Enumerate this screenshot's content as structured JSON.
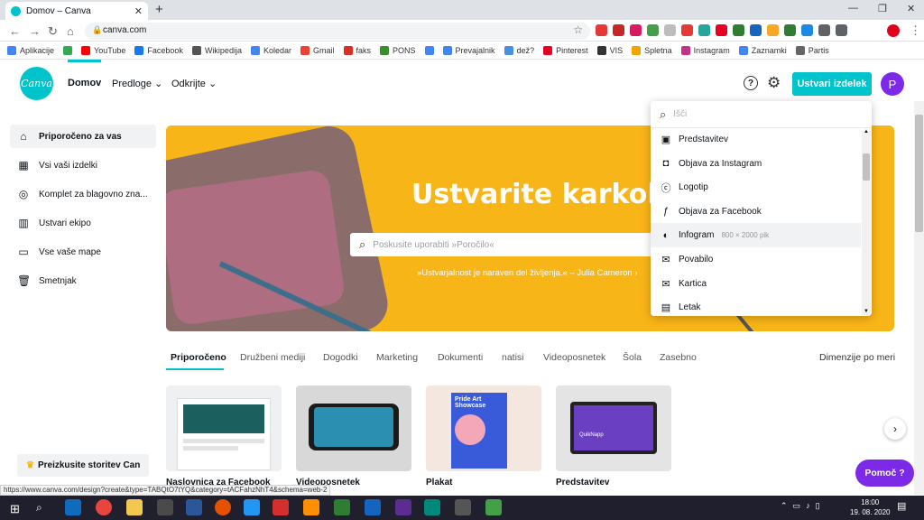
{
  "browser": {
    "tab_title": "Domov – Canva",
    "url": "canva.com",
    "status_url": "https://www.canva.com/design?create&type=TABQtO7tYQ&category=tACFahzNhT4&schema=web-2",
    "bookmarks": [
      {
        "label": "Aplikacije",
        "color": "#4285f4"
      },
      {
        "label": "",
        "color": "#34a853"
      },
      {
        "label": "YouTube",
        "color": "#ff0000"
      },
      {
        "label": "Facebook",
        "color": "#1877f2"
      },
      {
        "label": "Wikipedija",
        "color": "#555555"
      },
      {
        "label": "Koledar",
        "color": "#4285f4"
      },
      {
        "label": "Gmail",
        "color": "#ea4335"
      },
      {
        "label": "faks",
        "color": "#d93025"
      },
      {
        "label": "PONS",
        "color": "#3c8d2f"
      },
      {
        "label": "",
        "color": "#4285f4"
      },
      {
        "label": "Prevajalnik",
        "color": "#4285f4"
      },
      {
        "label": "dež?",
        "color": "#4a90e2"
      },
      {
        "label": "Pinterest",
        "color": "#e60023"
      },
      {
        "label": "VIS",
        "color": "#333333"
      },
      {
        "label": "Spletna",
        "color": "#f4a300"
      },
      {
        "label": "Instagram",
        "color": "#c13584"
      },
      {
        "label": "Zaznamki",
        "color": "#4285f4"
      },
      {
        "label": "Partis",
        "color": "#666666"
      }
    ]
  },
  "header": {
    "logo": "Canva",
    "nav": [
      "Domov",
      "Predloge",
      "Odkrijte"
    ],
    "create_button": "Ustvari izdelek",
    "avatar_initial": "P"
  },
  "sidebar": {
    "items": [
      {
        "label": "Priporočeno za vas",
        "icon": "home-icon",
        "glyph": "⌂"
      },
      {
        "label": "Vsi vaši izdelki",
        "icon": "grid-icon",
        "glyph": "▦"
      },
      {
        "label": "Komplet za blagovno zna...",
        "icon": "brand-kit-icon",
        "glyph": "◎"
      },
      {
        "label": "Ustvari ekipo",
        "icon": "team-icon",
        "glyph": "▥"
      },
      {
        "label": "Vse vaše mape",
        "icon": "folder-icon",
        "glyph": "▭"
      },
      {
        "label": "Smetnjak",
        "icon": "trash-icon",
        "glyph": "🗑"
      }
    ],
    "promo": "Preizkusite storitev Can"
  },
  "banner": {
    "title": "Ustvarite karkoli.",
    "search_placeholder": "Poskusite uporabiti »Poročilo«",
    "quote": "»Ustvarjalnost je naraven del življenja.« – Julia Cameron ›"
  },
  "categories": [
    "Priporočeno",
    "Družbeni mediji",
    "Dogodki",
    "Marketing",
    "Dokumenti",
    "natisi",
    "Videoposnetek",
    "Šola",
    "Zasebno"
  ],
  "dimensions_link": "Dimenzije po meri",
  "cards": [
    {
      "label": "Naslovnica za Facebook"
    },
    {
      "label": "Videoposnetek"
    },
    {
      "label": "Plakat",
      "art": "Pride Art Showcase"
    },
    {
      "label": "Predstavitev",
      "art": "QuikNapp"
    }
  ],
  "dropdown": {
    "search_placeholder": "Išči",
    "items": [
      {
        "label": "Predstavitev",
        "glyph": "▣",
        "sub": ""
      },
      {
        "label": "Objava za Instagram",
        "glyph": "◘",
        "sub": ""
      },
      {
        "label": "Logotip",
        "glyph": "ⓒ",
        "sub": ""
      },
      {
        "label": "Objava za Facebook",
        "glyph": "ƒ",
        "sub": ""
      },
      {
        "label": "Infogram",
        "glyph": "◐",
        "sub": "800 × 2000 pik"
      },
      {
        "label": "Povabilo",
        "glyph": "✉",
        "sub": ""
      },
      {
        "label": "Kartica",
        "glyph": "✉",
        "sub": ""
      },
      {
        "label": "Letak",
        "glyph": "▤",
        "sub": ""
      }
    ]
  },
  "help_button": "Pomoč ?",
  "taskbar": {
    "time": "18:00",
    "date": "19. 08. 2020"
  }
}
